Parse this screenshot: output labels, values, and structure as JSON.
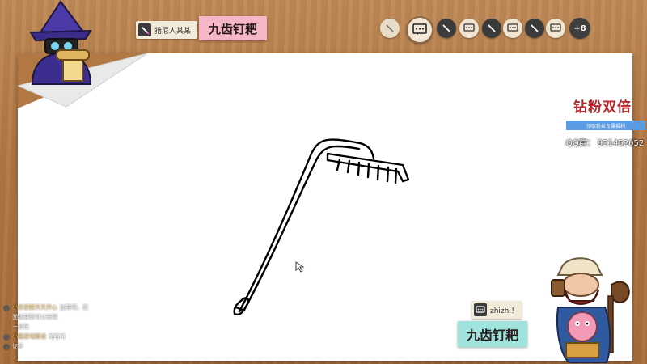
{
  "drawer": {
    "name": "猎尼人某某",
    "icon": "pencil-icon"
  },
  "word": {
    "top": "九齿钉耙",
    "bottom": "九齿钉耙"
  },
  "players": {
    "more_count": "+8",
    "active_icon": "chat-bubble-icon"
  },
  "promo": {
    "title": "钻粉双倍",
    "subtitle": "领取粉丝专属福利",
    "qq": "QQ群：  921452052"
  },
  "guess": {
    "user": "zhizhi！",
    "icon": "chat-bubble-icon"
  },
  "chat": {
    "messages": [
      {
        "name": "小苏想要天天开心",
        "text": "加群啊，前"
      },
      {
        "name": "",
        "text": "面那群聊可以去啊"
      },
      {
        "name": "",
        "text": "一起玩"
      },
      {
        "name": "小猫游戏解说",
        "text": "哈哈哈"
      },
      {
        "name": "",
        "text": "你好"
      }
    ]
  },
  "colors": {
    "wood": "#b27844",
    "pink_card": "#f5b6c8",
    "teal_card": "#9fe3dc",
    "promo_red": "#b4262a",
    "promo_blue": "#5b9be2"
  }
}
